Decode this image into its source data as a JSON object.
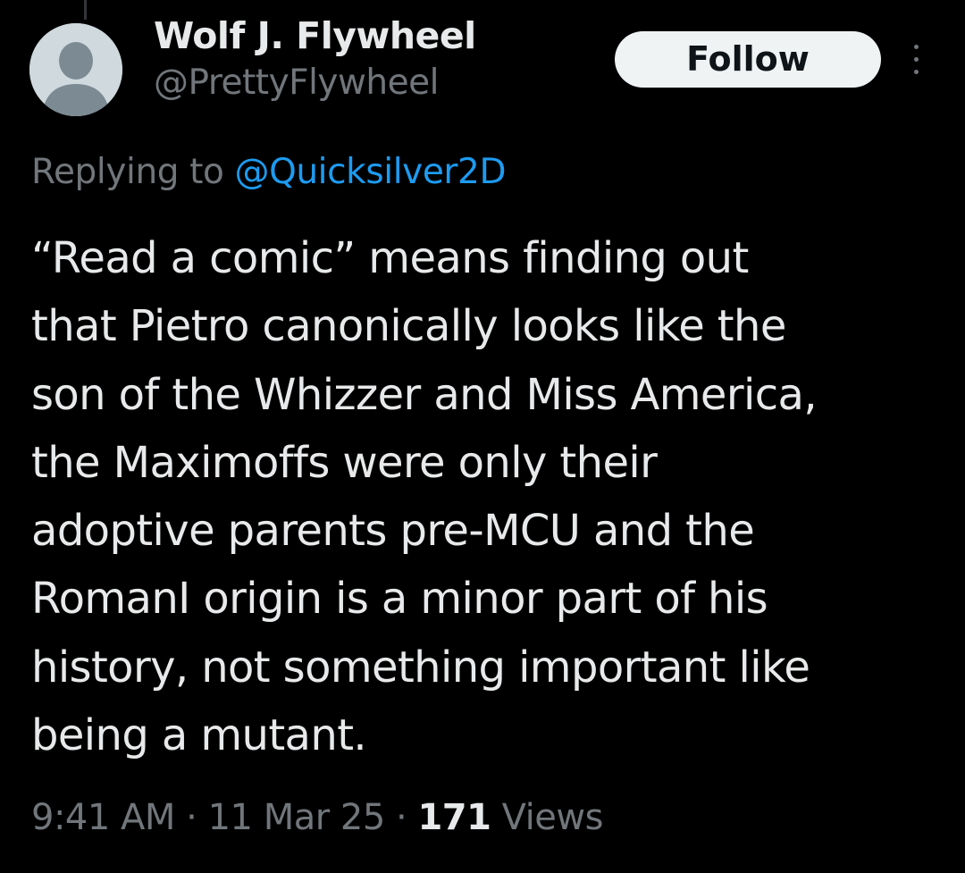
{
  "author": {
    "display_name": "Wolf J. Flywheel",
    "handle": "@PrettyFlywheel",
    "avatar_icon": "default-profile-icon"
  },
  "actions": {
    "follow_label": "Follow",
    "more_icon": "more-vertical-icon"
  },
  "reply": {
    "prefix": "Replying to ",
    "handle": "@Quicksilver2D"
  },
  "tweet": {
    "lines": [
      "“Read a comic” means finding out",
      "that Pietro canonically looks like the",
      "son of the Whizzer and Miss America,",
      "the Maximoffs were only their",
      "adoptive parents pre-MCU and the",
      "RomanI origin is a minor part of his",
      "history, not something important like",
      "being a mutant."
    ]
  },
  "meta": {
    "time": "9:41 AM",
    "separator": " · ",
    "date": "11 Mar 25",
    "views_count": "171",
    "views_label": " Views"
  },
  "colors": {
    "background": "#000000",
    "primary_text": "#e7e9ea",
    "secondary_text": "#71767b",
    "link": "#1d9bf0",
    "follow_bg": "#eff3f4"
  }
}
